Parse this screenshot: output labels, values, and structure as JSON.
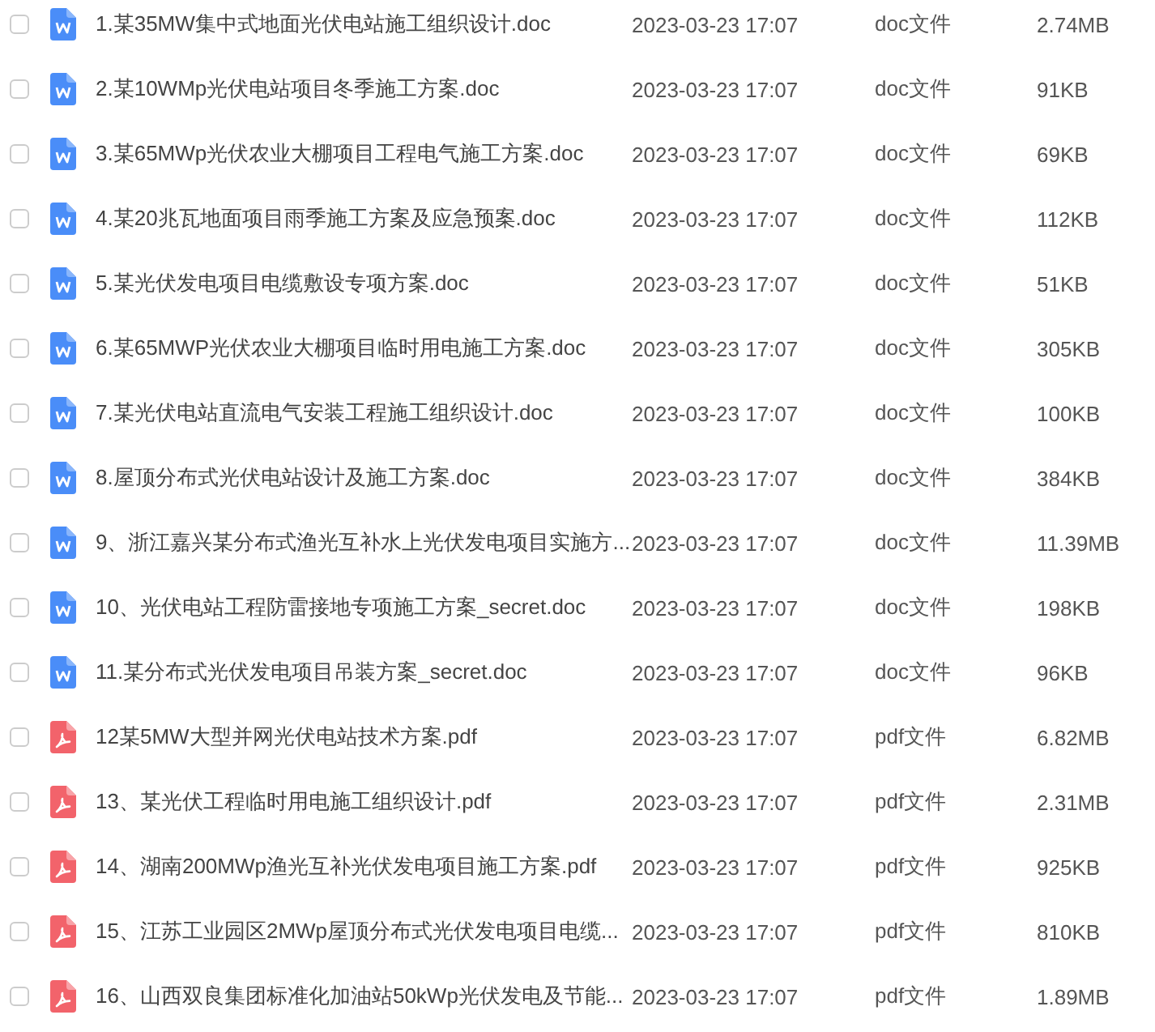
{
  "files": [
    {
      "kind": "doc",
      "checked": false,
      "name": "1.某35MW集中式地面光伏电站施工组织设计.doc",
      "date": "2023-03-23 17:07",
      "type": "doc文件",
      "size": "2.74MB"
    },
    {
      "kind": "doc",
      "checked": false,
      "name": "2.某10WMp光伏电站项目冬季施工方案.doc",
      "date": "2023-03-23 17:07",
      "type": "doc文件",
      "size": "91KB"
    },
    {
      "kind": "doc",
      "checked": false,
      "name": "3.某65MWp光伏农业大棚项目工程电气施工方案.doc",
      "date": "2023-03-23 17:07",
      "type": "doc文件",
      "size": "69KB"
    },
    {
      "kind": "doc",
      "checked": false,
      "name": "4.某20兆瓦地面项目雨季施工方案及应急预案.doc",
      "date": "2023-03-23 17:07",
      "type": "doc文件",
      "size": "112KB"
    },
    {
      "kind": "doc",
      "checked": false,
      "name": "5.某光伏发电项目电缆敷设专项方案.doc",
      "date": "2023-03-23 17:07",
      "type": "doc文件",
      "size": "51KB"
    },
    {
      "kind": "doc",
      "checked": false,
      "name": "6.某65MWP光伏农业大棚项目临时用电施工方案.doc",
      "date": "2023-03-23 17:07",
      "type": "doc文件",
      "size": "305KB"
    },
    {
      "kind": "doc",
      "checked": false,
      "name": "7.某光伏电站直流电气安装工程施工组织设计.doc",
      "date": "2023-03-23 17:07",
      "type": "doc文件",
      "size": "100KB"
    },
    {
      "kind": "doc",
      "checked": false,
      "name": "8.屋顶分布式光伏电站设计及施工方案.doc",
      "date": "2023-03-23 17:07",
      "type": "doc文件",
      "size": "384KB"
    },
    {
      "kind": "doc",
      "checked": false,
      "name": "9、浙江嘉兴某分布式渔光互补水上光伏发电项目实施方...",
      "date": "2023-03-23 17:07",
      "type": "doc文件",
      "size": "11.39MB"
    },
    {
      "kind": "doc",
      "checked": false,
      "name": "10、光伏电站工程防雷接地专项施工方案_secret.doc",
      "date": "2023-03-23 17:07",
      "type": "doc文件",
      "size": "198KB"
    },
    {
      "kind": "doc",
      "checked": false,
      "name": "11.某分布式光伏发电项目吊装方案_secret.doc",
      "date": "2023-03-23 17:07",
      "type": "doc文件",
      "size": "96KB"
    },
    {
      "kind": "pdf",
      "checked": false,
      "name": "12某5MW大型并网光伏电站技术方案.pdf",
      "date": "2023-03-23 17:07",
      "type": "pdf文件",
      "size": "6.82MB"
    },
    {
      "kind": "pdf",
      "checked": false,
      "name": "13、某光伏工程临时用电施工组织设计.pdf",
      "date": "2023-03-23 17:07",
      "type": "pdf文件",
      "size": "2.31MB"
    },
    {
      "kind": "pdf",
      "checked": false,
      "name": "14、湖南200MWp渔光互补光伏发电项目施工方案.pdf",
      "date": "2023-03-23 17:07",
      "type": "pdf文件",
      "size": "925KB"
    },
    {
      "kind": "pdf",
      "checked": false,
      "name": "15、江苏工业园区2MWp屋顶分布式光伏发电项目电缆...",
      "date": "2023-03-23 17:07",
      "type": "pdf文件",
      "size": "810KB"
    },
    {
      "kind": "pdf",
      "checked": false,
      "name": "16、山西双良集团标准化加油站50kWp光伏发电及节能...",
      "date": "2023-03-23 17:07",
      "type": "pdf文件",
      "size": "1.89MB"
    }
  ]
}
